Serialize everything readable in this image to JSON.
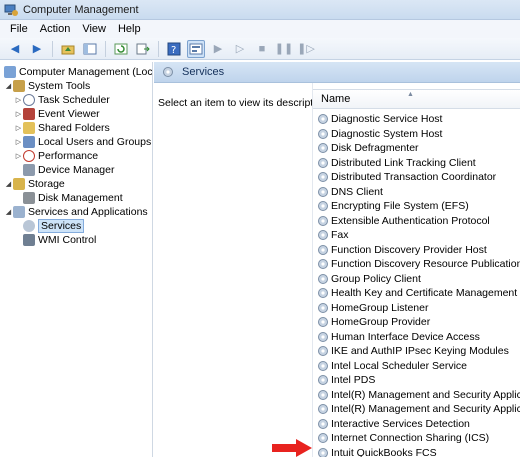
{
  "window": {
    "title": "Computer Management"
  },
  "menu": [
    "File",
    "Action",
    "View",
    "Help"
  ],
  "toolbar": {
    "icons": [
      "back-icon",
      "forward-icon",
      "up-folder-icon",
      "show-hide-tree-icon",
      "refresh-icon",
      "export-list-icon",
      "help-icon",
      "properties-icon",
      "start-service-icon",
      "start-service-params-icon",
      "stop-service-icon",
      "pause-service-icon",
      "restart-service-icon"
    ]
  },
  "tree": {
    "items": [
      {
        "label": "Computer Management (Local)"
      },
      {
        "label": "System Tools"
      },
      {
        "label": "Task Scheduler"
      },
      {
        "label": "Event Viewer"
      },
      {
        "label": "Shared Folders"
      },
      {
        "label": "Local Users and Groups"
      },
      {
        "label": "Performance"
      },
      {
        "label": "Device Manager"
      },
      {
        "label": "Storage"
      },
      {
        "label": "Disk Management"
      },
      {
        "label": "Services and Applications"
      },
      {
        "label": "Services"
      },
      {
        "label": "WMI Control"
      }
    ]
  },
  "content": {
    "header_title": "Services",
    "description": "Select an item to view its description.",
    "column_name": "Name",
    "services": [
      "Diagnostic Service Host",
      "Diagnostic System Host",
      "Disk Defragmenter",
      "Distributed Link Tracking Client",
      "Distributed Transaction Coordinator",
      "DNS Client",
      "Encrypting File System (EFS)",
      "Extensible Authentication Protocol",
      "Fax",
      "Function Discovery Provider Host",
      "Function Discovery Resource Publication",
      "Group Policy Client",
      "Health Key and Certificate Management",
      "HomeGroup Listener",
      "HomeGroup Provider",
      "Human Interface Device Access",
      "IKE and AuthIP IPsec Keying Modules",
      "Intel Local Scheduler Service",
      "Intel PDS",
      "Intel(R) Management and Security Applicat...",
      "Intel(R) Management and Security Applicat...",
      "Interactive Services Detection",
      "Internet Connection Sharing (ICS)",
      "Intuit QuickBooks FCS"
    ]
  },
  "colors": {
    "arrow": "#e8231f",
    "selection": "#cde3f8",
    "header": "#c9dbef"
  }
}
